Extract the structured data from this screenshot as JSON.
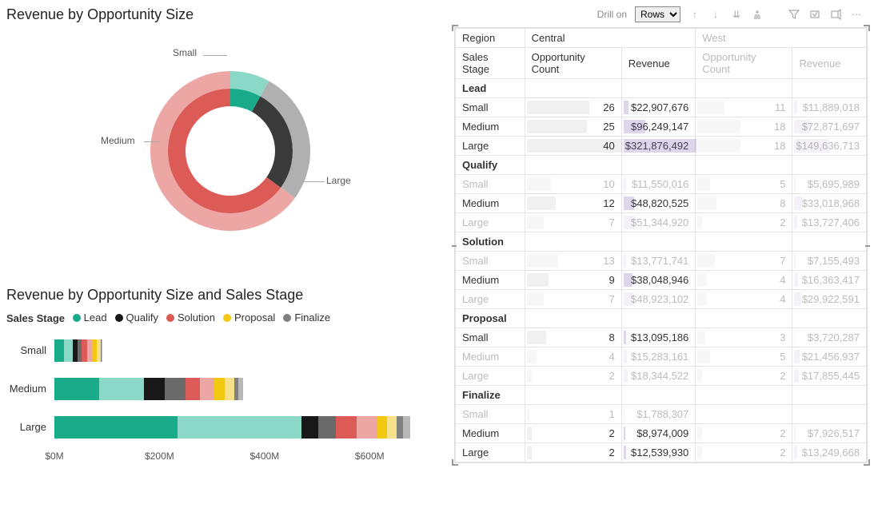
{
  "colors": {
    "lead": "#1aab8a",
    "lead_light": "#8bd8c7",
    "qualify": "#181818",
    "qualify_light": "#6a6a6a",
    "solution": "#dc5b57",
    "solution_light": "#eca6a4",
    "proposal": "#f2c811",
    "proposal_light": "#f6e08a",
    "finalize": "#808080",
    "finalize_light": "#b8b8b8",
    "grey_ring": "#8a8a8a"
  },
  "donut": {
    "title": "Revenue by Opportunity Size",
    "labels": {
      "small": "Small",
      "medium": "Medium",
      "large": "Large"
    }
  },
  "bar": {
    "title": "Revenue by Opportunity Size and Sales Stage",
    "legend_title": "Sales Stage",
    "legend": [
      "Lead",
      "Qualify",
      "Solution",
      "Proposal",
      "Finalize"
    ],
    "categories": [
      "Small",
      "Medium",
      "Large"
    ],
    "x_ticks": [
      "$0M",
      "$200M",
      "$400M",
      "$600M"
    ]
  },
  "toolbar": {
    "drill_label": "Drill on",
    "drill_value": "Rows"
  },
  "matrix": {
    "row_header1": "Region",
    "row_header2": "Sales Stage",
    "regions": [
      "Central",
      "West"
    ],
    "col_headers": [
      "Opportunity Count",
      "Revenue"
    ],
    "stages": [
      {
        "name": "Lead",
        "rows": [
          {
            "size": "Small",
            "c_cnt": 26,
            "c_rev": "$22,907,676",
            "w_cnt": 11,
            "w_rev": "$11,889,018",
            "hi": true
          },
          {
            "size": "Medium",
            "c_cnt": 25,
            "c_rev": "$96,249,147",
            "w_cnt": 18,
            "w_rev": "$72,871,697",
            "hi": true
          },
          {
            "size": "Large",
            "c_cnt": 40,
            "c_rev": "$321,876,492",
            "w_cnt": 18,
            "w_rev": "$149,636,713",
            "hi": true
          }
        ]
      },
      {
        "name": "Qualify",
        "rows": [
          {
            "size": "Small",
            "c_cnt": 10,
            "c_rev": "$11,550,016",
            "w_cnt": 5,
            "w_rev": "$5,695,989",
            "hi": false
          },
          {
            "size": "Medium",
            "c_cnt": 12,
            "c_rev": "$48,820,525",
            "w_cnt": 8,
            "w_rev": "$33,018,968",
            "hi": true
          },
          {
            "size": "Large",
            "c_cnt": 7,
            "c_rev": "$51,344,920",
            "w_cnt": 2,
            "w_rev": "$13,727,406",
            "hi": false
          }
        ]
      },
      {
        "name": "Solution",
        "rows": [
          {
            "size": "Small",
            "c_cnt": 13,
            "c_rev": "$13,771,741",
            "w_cnt": 7,
            "w_rev": "$7,155,493",
            "hi": false
          },
          {
            "size": "Medium",
            "c_cnt": 9,
            "c_rev": "$38,048,946",
            "w_cnt": 4,
            "w_rev": "$16,363,417",
            "hi": true
          },
          {
            "size": "Large",
            "c_cnt": 7,
            "c_rev": "$48,923,102",
            "w_cnt": 4,
            "w_rev": "$29,922,591",
            "hi": false
          }
        ]
      },
      {
        "name": "Proposal",
        "rows": [
          {
            "size": "Small",
            "c_cnt": 8,
            "c_rev": "$13,095,186",
            "w_cnt": 3,
            "w_rev": "$3,720,287",
            "hi": true
          },
          {
            "size": "Medium",
            "c_cnt": 4,
            "c_rev": "$15,283,161",
            "w_cnt": 5,
            "w_rev": "$21,456,937",
            "hi": false
          },
          {
            "size": "Large",
            "c_cnt": 2,
            "c_rev": "$18,344,522",
            "w_cnt": 2,
            "w_rev": "$17,855,445",
            "hi": false
          }
        ]
      },
      {
        "name": "Finalize",
        "rows": [
          {
            "size": "Small",
            "c_cnt": 1,
            "c_rev": "$1,788,307",
            "w_cnt": "",
            "w_rev": "",
            "hi": false
          },
          {
            "size": "Medium",
            "c_cnt": 2,
            "c_rev": "$8,974,009",
            "w_cnt": 2,
            "w_rev": "$7,926,517",
            "hi": true
          },
          {
            "size": "Large",
            "c_cnt": 2,
            "c_rev": "$12,539,930",
            "w_cnt": 2,
            "w_rev": "$13,249,668",
            "hi": true
          }
        ]
      }
    ]
  },
  "chart_data": [
    {
      "type": "pie",
      "title": "Revenue by Opportunity Size",
      "categories": [
        "Small",
        "Medium",
        "Large"
      ],
      "values_outer_pct": [
        8,
        27,
        65
      ],
      "values_inner_pct": [
        8,
        27,
        65
      ],
      "note": "Donut with two concentric rings; outer ring colored Lead green/grey/solution-red-light, inner ring darker shades. Percentages estimated from arc sweep."
    },
    {
      "type": "bar",
      "orientation": "horizontal_stacked",
      "title": "Revenue by Opportunity Size and Sales Stage",
      "xlabel": "Revenue",
      "xlim": [
        0,
        700
      ],
      "x_ticks": [
        0,
        200,
        400,
        600
      ],
      "x_unit": "$M",
      "categories": [
        "Small",
        "Medium",
        "Large"
      ],
      "series": [
        {
          "name": "Lead",
          "values": [
            35,
            170,
            470
          ]
        },
        {
          "name": "Qualify",
          "values": [
            17,
            80,
            65
          ]
        },
        {
          "name": "Solution",
          "values": [
            20,
            55,
            80
          ]
        },
        {
          "name": "Proposal",
          "values": [
            17,
            37,
            36
          ]
        },
        {
          "name": "Finalize",
          "values": [
            2,
            17,
            26
          ]
        }
      ],
      "legend": [
        "Lead",
        "Qualify",
        "Solution",
        "Proposal",
        "Finalize"
      ],
      "note": "Each stage has highlighted + faded sub-segments; totals estimated from gridlines (~$90M, ~$360M, ~$680M)."
    }
  ]
}
